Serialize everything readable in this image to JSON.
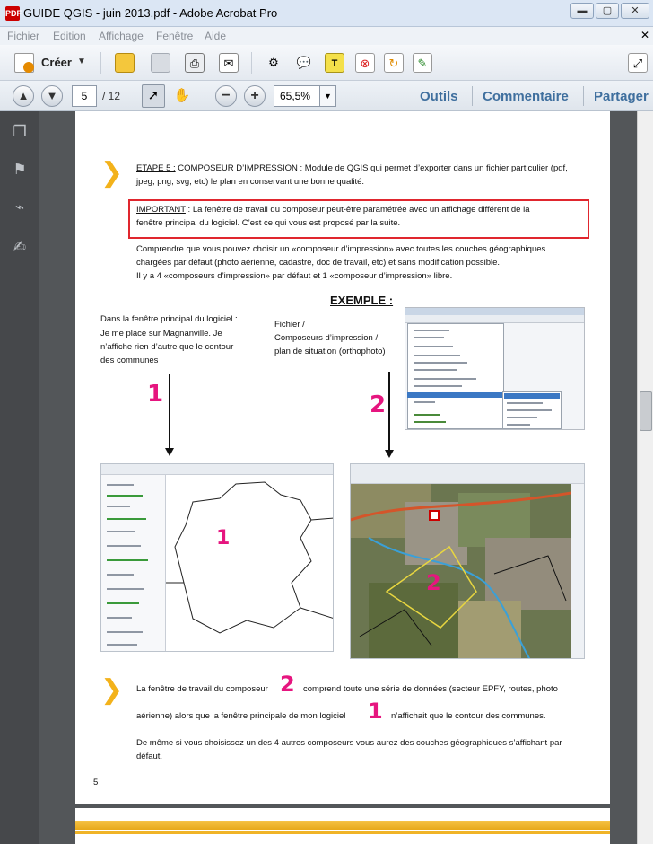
{
  "window": {
    "title": "GUIDE QGIS - juin 2013.pdf - Adobe Acrobat Pro",
    "app_icon": "pdf-icon"
  },
  "menubar": [
    "Fichier",
    "Edition",
    "Affichage",
    "Fenêtre",
    "Aide"
  ],
  "toolbar1": {
    "create_label": "Créer",
    "icons": [
      "open-folder-icon",
      "save-icon",
      "print-icon",
      "email-icon",
      "settings-icon",
      "comment-icon",
      "highlight-icon",
      "sign-icon",
      "export-icon",
      "edit-icon",
      "expand-icon"
    ]
  },
  "toolbar2": {
    "page_current": "5",
    "page_total": "/ 12",
    "zoom": "65,5%",
    "panes": [
      "Outils",
      "Commentaire",
      "Partager"
    ]
  },
  "document": {
    "step5_label": "ETAPE 5 :",
    "step5_text": " COMPOSEUR D’IMPRESSION : Module de QGIS qui permet d’exporter dans un fichier particulier (pdf,",
    "step5_line2": "jpeg, png, svg, etc) le plan en conservant une bonne qualité.",
    "important_label": "IMPORTANT",
    "important_line1": " : La fenêtre de travail du composeur peut-être paramétrée avec un affichage différent de la",
    "important_line2": "fenêtre principal du logiciel. C’est ce qui vous est proposé par la suite.",
    "para1_line1": "Comprendre que vous pouvez choisir un «composeur d’impression» avec toutes les couches géographiques",
    "para1_line2": "chargées par défaut (photo aérienne, cadastre, doc de travail, etc) et sans modification possible.",
    "para1_line3": "Il y a 4 «composeurs d’impression» par défaut et 1 «composeur d’impression» libre.",
    "example_title": "EXEMPLE :",
    "left_caption": [
      "Dans la fenêtre principal du logiciel :",
      "Je me place sur Magnanville. Je",
      "n’affiche rien d’autre que le contour",
      "des communes"
    ],
    "right_caption": [
      "Fichier /",
      "Composeurs d’impression /",
      "plan de situation (orthophoto)"
    ],
    "big_num_1": "1",
    "big_num_2": "2",
    "para2_a": "La fenêtre de travail du composeur",
    "para2_b": "comprend toute une série de données (secteur EPFY, routes, photo",
    "para2_c": "aérienne) alors que la fenêtre principale de mon logiciel",
    "para2_d": "n’affichait que le contour des communes.",
    "para3_line1": "De même si vous choisissez un des 4 autres composeurs vous aurez des couches géographiques s’affichant par",
    "para3_line2": "défaut.",
    "page_number": "5"
  },
  "colors": {
    "accent_chevron": "#f3b21b",
    "magenta_numbers": "#e6157f",
    "important_border": "#e0262e",
    "pane_link": "#3f6f9e"
  }
}
